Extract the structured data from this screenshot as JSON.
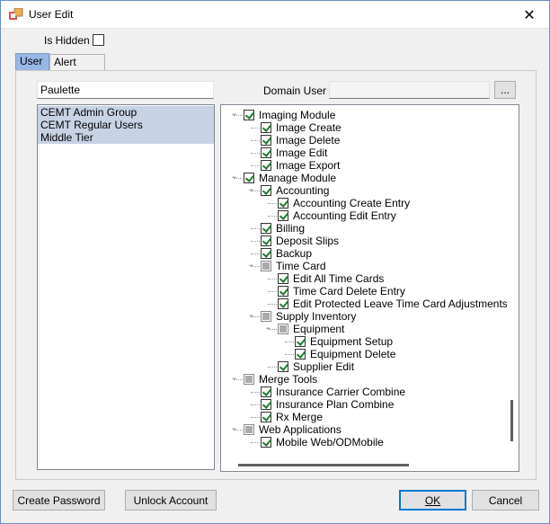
{
  "window": {
    "title": "User Edit",
    "close_glyph": "✕"
  },
  "is_hidden": {
    "label": "Is Hidden",
    "checked": false
  },
  "tabs": [
    {
      "label": "User"
    },
    {
      "label": "Alert Subs"
    }
  ],
  "user_name": "Paulette",
  "domain_user": {
    "label": "Domain User",
    "value": "",
    "browse_label": "..."
  },
  "groups": [
    {
      "label": "CEMT Admin Group"
    },
    {
      "label": "CEMT Regular Users"
    },
    {
      "label": "Middle Tier"
    }
  ],
  "tree": [
    {
      "label": "Imaging Module",
      "level": 0,
      "state": "checked",
      "expander": "−"
    },
    {
      "label": "Image Create",
      "level": 1,
      "state": "checked"
    },
    {
      "label": "Image Delete",
      "level": 1,
      "state": "checked"
    },
    {
      "label": "Image Edit",
      "level": 1,
      "state": "checked"
    },
    {
      "label": "Image Export",
      "level": 1,
      "state": "checked"
    },
    {
      "label": "Manage Module",
      "level": 0,
      "state": "checked",
      "expander": "−"
    },
    {
      "label": "Accounting",
      "level": 1,
      "state": "checked",
      "expander": "−"
    },
    {
      "label": "Accounting Create Entry",
      "level": 2,
      "state": "checked"
    },
    {
      "label": "Accounting Edit Entry",
      "level": 2,
      "state": "checked"
    },
    {
      "label": "Billing",
      "level": 1,
      "state": "checked"
    },
    {
      "label": "Deposit Slips",
      "level": 1,
      "state": "checked"
    },
    {
      "label": "Backup",
      "level": 1,
      "state": "checked"
    },
    {
      "label": "Time Card",
      "level": 1,
      "state": "indeterminate",
      "expander": "−"
    },
    {
      "label": "Edit All Time Cards",
      "level": 2,
      "state": "checked"
    },
    {
      "label": "Time Card Delete Entry",
      "level": 2,
      "state": "checked"
    },
    {
      "label": "Edit Protected Leave Time Card Adjustments",
      "level": 2,
      "state": "checked"
    },
    {
      "label": "Supply Inventory",
      "level": 1,
      "state": "indeterminate",
      "expander": "−"
    },
    {
      "label": "Equipment",
      "level": 2,
      "state": "indeterminate",
      "expander": "−"
    },
    {
      "label": "Equipment Setup",
      "level": 3,
      "state": "checked"
    },
    {
      "label": "Equipment Delete",
      "level": 3,
      "state": "checked"
    },
    {
      "label": "Supplier Edit",
      "level": 2,
      "state": "checked"
    },
    {
      "label": "Merge Tools",
      "level": 0,
      "state": "indeterminate",
      "expander": "−"
    },
    {
      "label": "Insurance Carrier Combine",
      "level": 1,
      "state": "checked"
    },
    {
      "label": "Insurance Plan Combine",
      "level": 1,
      "state": "checked"
    },
    {
      "label": "Rx Merge",
      "level": 1,
      "state": "checked"
    },
    {
      "label": "Web Applications",
      "level": 0,
      "state": "indeterminate",
      "expander": "−"
    },
    {
      "label": "Mobile Web/ODMobile",
      "level": 1,
      "state": "checked"
    }
  ],
  "buttons": {
    "create_password": "Create Password",
    "unlock_account": "Unlock Account",
    "ok": "OK",
    "cancel": "Cancel"
  },
  "colors": {
    "accent": "#0078d7",
    "tab_active": "#99b7e6",
    "selection": "#c7d2e5",
    "check": "#1e7b2c"
  }
}
